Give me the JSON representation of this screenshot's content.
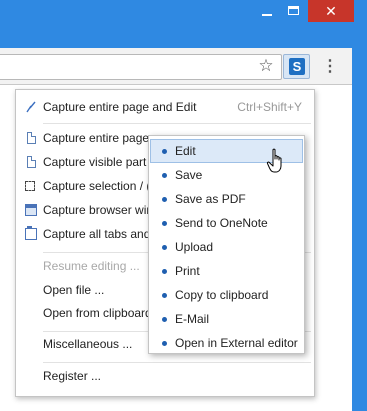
{
  "window": {
    "accent_color": "#2f89e2",
    "close_color": "#c7352a"
  },
  "toolbar": {
    "extension_icon_letter": "S"
  },
  "menu": {
    "items": [
      {
        "label": "Capture entire page and Edit",
        "accel": "Ctrl+Shift+Y",
        "icon": "lightning-icon"
      },
      {
        "label": "Capture entire page",
        "icon": "page-icon"
      },
      {
        "label": "Capture visible part",
        "icon": "visible-part-icon"
      },
      {
        "label": "Capture selection / (",
        "icon": "selection-icon"
      },
      {
        "label": "Capture browser wir",
        "icon": "browser-window-icon"
      },
      {
        "label": "Capture all tabs and",
        "icon": "tabs-icon"
      },
      {
        "label": "Resume editing ..."
      },
      {
        "label": "Open file ..."
      },
      {
        "label": "Open from clipboard"
      },
      {
        "label": "Miscellaneous ..."
      },
      {
        "label": "Register ..."
      }
    ]
  },
  "submenu": {
    "items": [
      {
        "label": "Edit"
      },
      {
        "label": "Save"
      },
      {
        "label": "Save as PDF"
      },
      {
        "label": "Send to OneNote"
      },
      {
        "label": "Upload"
      },
      {
        "label": "Print"
      },
      {
        "label": "Copy to clipboard"
      },
      {
        "label": "E-Mail"
      },
      {
        "label": "Open in External editor"
      }
    ]
  }
}
